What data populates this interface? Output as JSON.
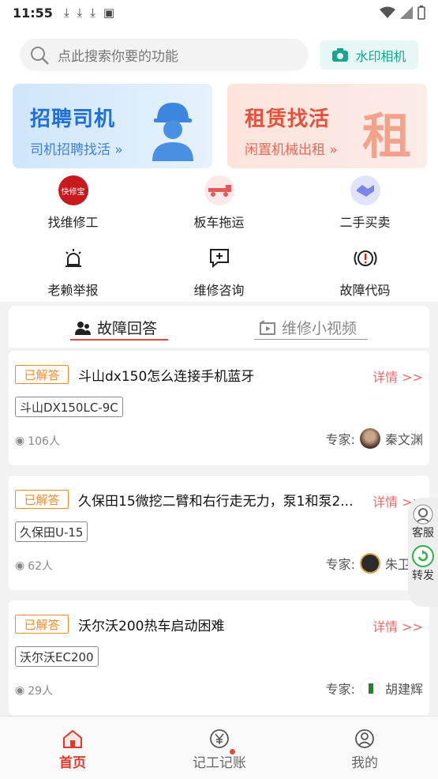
{
  "status_bar": {
    "time": "11:55"
  },
  "search": {
    "placeholder": "点此搜索你要的功能",
    "camera_label": "水印相机"
  },
  "banners": [
    {
      "title": "招聘司机",
      "subtitle": "司机招聘找活 »"
    },
    {
      "title": "租赁找活",
      "subtitle": "闲置机械出租 »",
      "big_char": "租"
    }
  ],
  "grid": [
    {
      "label": "找维修工",
      "icon": "kuaixiubao-icon",
      "icon_text": "快修宝"
    },
    {
      "label": "板车拖运",
      "icon": "flatbed-truck-icon"
    },
    {
      "label": "二手买卖",
      "icon": "handshake-icon"
    },
    {
      "label": "老赖举报",
      "icon": "alarm-icon"
    },
    {
      "label": "维修咨询",
      "icon": "chat-plus-icon"
    },
    {
      "label": "故障代码",
      "icon": "warning-code-icon"
    }
  ],
  "tabs": [
    {
      "label": "故障回答",
      "icon": "users-icon",
      "active": true
    },
    {
      "label": "维修小视频",
      "icon": "video-icon",
      "active": false
    }
  ],
  "questions": [
    {
      "status": "已解答",
      "title": "斗山dx150怎么连接手机蓝牙",
      "detail": "详情 >>",
      "tag": "斗山DX150LC-9C",
      "views": "106人",
      "expert_label": "专家:",
      "expert_name": "秦文渊"
    },
    {
      "status": "已解答",
      "title": "久保田15微挖二臂和右行走无力，泵1和泵2...",
      "detail": "详情 >>",
      "tag": "久保田U-15",
      "views": "62人",
      "expert_label": "专家:",
      "expert_name": "朱卫东"
    },
    {
      "status": "已解答",
      "title": "沃尔沃200热车启动困难",
      "detail": "详情 >>",
      "tag": "沃尔沃EC200",
      "views": "29人",
      "expert_label": "专家:",
      "expert_name": "胡建辉"
    }
  ],
  "float_buttons": [
    {
      "label": "客服",
      "icon": "customer-service-icon"
    },
    {
      "label": "转发",
      "icon": "share-icon"
    }
  ],
  "nav": [
    {
      "label": "首页",
      "icon": "home-icon",
      "active": true
    },
    {
      "label": "记工记账",
      "icon": "yuan-icon",
      "active": false,
      "has_dot": true
    },
    {
      "label": "我的",
      "icon": "profile-icon",
      "active": false
    }
  ],
  "colors": {
    "accent": "#e03a2f",
    "answered": "#f08c2c",
    "camera": "#1aa393",
    "banner_blue": "#1f6fd6",
    "banner_red": "#e5513a"
  }
}
